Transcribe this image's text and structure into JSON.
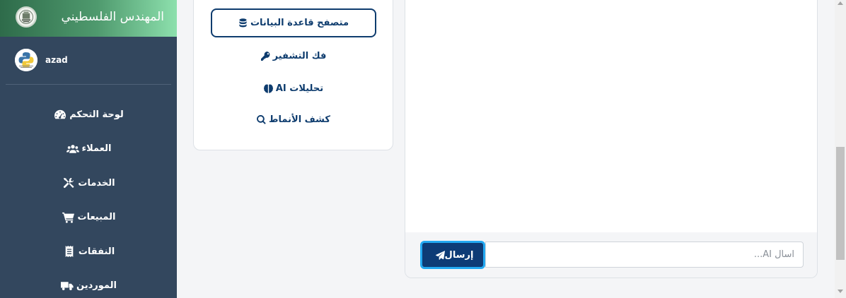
{
  "brand": {
    "title": "المهندس الفلسطيني",
    "logo_icon": "company-seal-logo"
  },
  "user": {
    "name": "azad",
    "avatar_icon": "python-logo-avatar"
  },
  "sidebar": {
    "items": [
      {
        "label": "لوحة التحكم",
        "icon": "tachometer-icon"
      },
      {
        "label": "العملاء",
        "icon": "users-icon"
      },
      {
        "label": "الخدمات",
        "icon": "tools-icon"
      },
      {
        "label": "المبيعات",
        "icon": "cart-icon"
      },
      {
        "label": "النفقات",
        "icon": "receipt-icon"
      },
      {
        "label": "الموردين",
        "icon": "truck-icon"
      }
    ]
  },
  "tools": {
    "db_browser": "متصفح قاعدة البيانات",
    "decrypt": "فك التشفير",
    "ai_analytics": "تحليلات AI",
    "pattern_detect": "كشف الأنماط"
  },
  "chat": {
    "input_placeholder": "اسأل AI...",
    "input_value": "",
    "send_label": "إرسال"
  },
  "colors": {
    "sidebar_bg": "#33475e",
    "brand_gradient_start": "#2e6b4a",
    "brand_gradient_end": "#8de0ad",
    "primary": "#0e3c6e",
    "send_border": "#23a9f2"
  }
}
